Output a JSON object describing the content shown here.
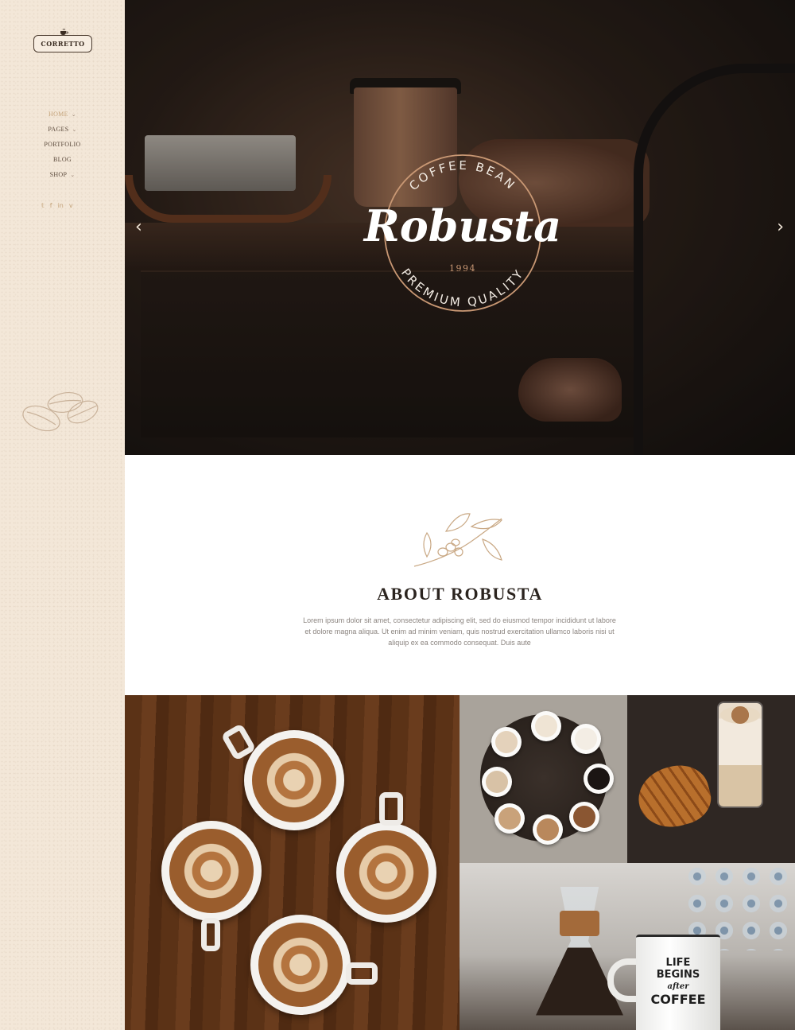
{
  "brand": {
    "name": "CORRETTO"
  },
  "nav": {
    "items": [
      {
        "label": "HOME",
        "has_dropdown": true,
        "active": true
      },
      {
        "label": "PAGES",
        "has_dropdown": true,
        "active": false
      },
      {
        "label": "PORTFOLIO",
        "has_dropdown": false,
        "active": false
      },
      {
        "label": "BLOG",
        "has_dropdown": false,
        "active": false
      },
      {
        "label": "SHOP",
        "has_dropdown": true,
        "active": false
      }
    ],
    "chevron": "⌄"
  },
  "social": {
    "twitter": "𝕥",
    "facebook": "f",
    "linkedin": "in",
    "vimeo": "v"
  },
  "hero": {
    "badge_top": "COFFEE BEAN",
    "badge_script": "Robusta",
    "badge_year": "1994",
    "badge_bottom": "PREMIUM QUALITY",
    "prev_arrow": "‹",
    "next_arrow": "›"
  },
  "about": {
    "title": "ABOUT ROBUSTA",
    "body": "Lorem ipsum dolor sit amet, consectetur adipiscing elit, sed do eiusmod tempor incididunt ut labore et dolore magna aliqua. Ut enim ad minim veniam, quis nostrud exercitation ullamco laboris nisi ut aliquip ex ea commodo consequat. Duis aute"
  },
  "gallery": {
    "mug_text": {
      "line1": "LIFE",
      "line2": "BEGINS",
      "line3": "after",
      "line4": "COFFEE"
    }
  },
  "colors": {
    "sidebar_bg": "#f3e7d8",
    "accent": "#c4a37a",
    "text_dark": "#2b241f",
    "text_muted": "#8c8580",
    "badge_copper": "#c99874"
  }
}
